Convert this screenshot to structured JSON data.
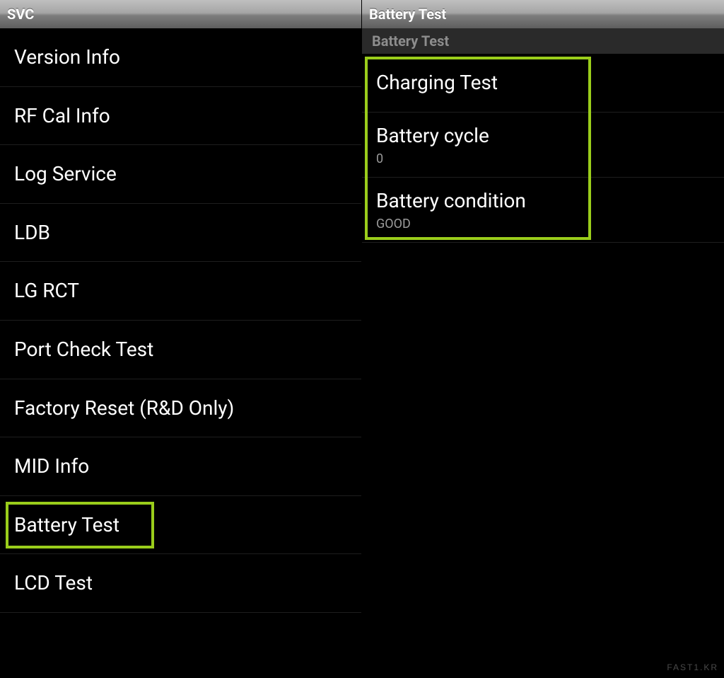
{
  "left": {
    "title": "SVC",
    "items": [
      "Version Info",
      "RF Cal Info",
      "Log Service",
      "LDB",
      "LG RCT",
      "Port Check Test",
      "Factory Reset (R&D Only)",
      "MID Info",
      "Battery Test",
      "LCD Test"
    ],
    "highlighted_index": 8
  },
  "right": {
    "title": "Battery Test",
    "sub_title": "Battery Test",
    "items": [
      {
        "label": "Charging Test"
      },
      {
        "label": "Battery cycle",
        "value": "0"
      },
      {
        "label": "Battery condition",
        "value": "GOOD"
      }
    ]
  },
  "watermark": "FAST1.KR"
}
